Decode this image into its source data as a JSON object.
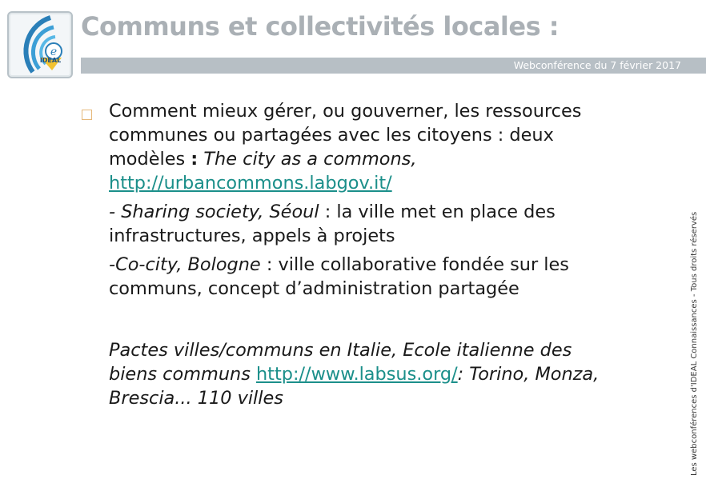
{
  "header": {
    "logo_text": "IDEAL",
    "title": "Communs et collectivités locales :",
    "subtitle": "Webconférence du 7 février 2017"
  },
  "body": {
    "p1_line1": "Comment mieux gérer, ou gouverner, les ressources",
    "p1_line2": "communes ou partagées avec les citoyens : deux",
    "p1_line3_a": "modèles ",
    "p1_line3_b": ":",
    "p1_line3_c": " The city as a commons,",
    "p1_link": "http://urbancommons.labgov.it/",
    "p2_italic": "- Sharing society, Séoul",
    "p2_rest_line1": " : la ville met en place des",
    "p2_line2": "infrastructures, appels à projets",
    "p3_italic": "-Co-city, Bologne",
    "p3_rest_line1": " : ville collaborative fondée sur les",
    "p3_line2": "communs, concept d’administration partagée",
    "p4_line1": "Pactes villes/communs en Italie, Ecole italienne des",
    "p4_line2_a": "biens communs ",
    "p4_link": "http://www.labsus.org/",
    "p4_line2_b": ": Torino, Monza,",
    "p4_line3": "Brescia... 110 villes"
  },
  "footer": {
    "vertical_text": "Les webconférences d'IDEAL Connaissances - Tous droits réservés"
  }
}
